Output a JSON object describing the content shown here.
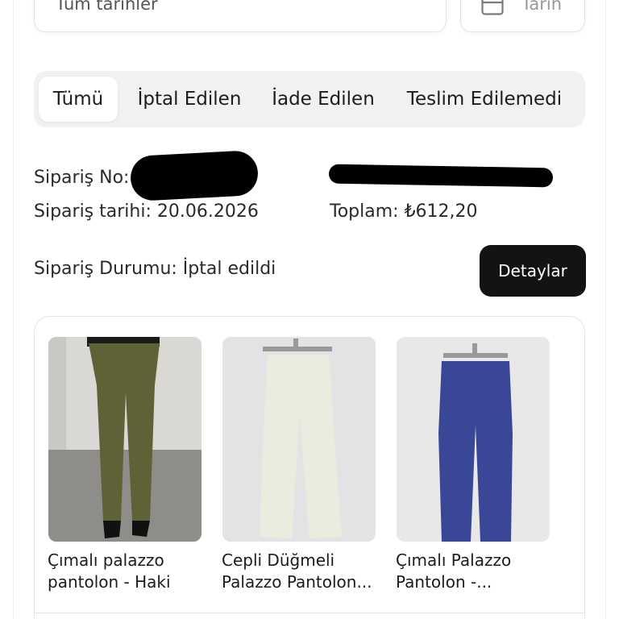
{
  "filters": {
    "date_range_value": "Tüm tarihler",
    "date_button_label": "Tarih"
  },
  "tabs": [
    {
      "label": "Tümü",
      "active": true
    },
    {
      "label": "İptal Edilen",
      "active": false
    },
    {
      "label": "İade Edilen",
      "active": false
    },
    {
      "label": "Teslim Edilemedi",
      "active": false
    }
  ],
  "order": {
    "number_label": "Sipariş No:",
    "date_label": "Sipariş tarihi:",
    "date_value": "20.06.2026",
    "total_label": "Toplam:",
    "total_value": "₺612,20",
    "status_label": "Sipariş Durumu:",
    "status_value": "İptal edildi",
    "details_button": "Detaylar"
  },
  "products": [
    {
      "name_line1": "Çımalı palazzo",
      "name_line2": "pantolon - Haki",
      "color": "#5f6137"
    },
    {
      "name_line1": "Cepli Düğmeli",
      "name_line2": "Palazzo Pantolon...",
      "color": "#ecebdf"
    },
    {
      "name_line1": "Çımalı Palazzo",
      "name_line2": "Pantolon -...",
      "color": "#3a4796"
    }
  ],
  "colors": {
    "button_bg": "#131313",
    "tab_bar_bg": "#f1f1ef"
  }
}
